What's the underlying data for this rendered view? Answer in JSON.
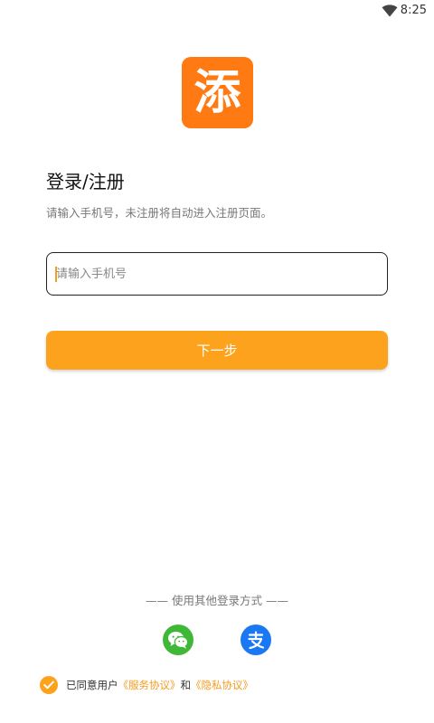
{
  "status_bar": {
    "time": "8:25",
    "wifi_icon": "wifi-icon"
  },
  "logo": {
    "glyph": "添",
    "color": "#ff7a12"
  },
  "header": {
    "title": "登录/注册",
    "subtitle": "请输入手机号，未注册将自动进入注册页面。"
  },
  "phone": {
    "placeholder": "请输入手机号",
    "value": ""
  },
  "next_button": {
    "label": "下一步",
    "color": "#fca21d"
  },
  "other_login": {
    "label": "—— 使用其他登录方式 ——",
    "options": [
      {
        "icon": "wechat-icon",
        "color": "#3fb838"
      },
      {
        "icon": "alipay-icon",
        "color": "#1a78f2"
      }
    ]
  },
  "agreement": {
    "checked": true,
    "prefix": "已同意用户",
    "service_link": "《服务协议》",
    "conjunction": "和",
    "privacy_link": "《隐私协议》"
  }
}
